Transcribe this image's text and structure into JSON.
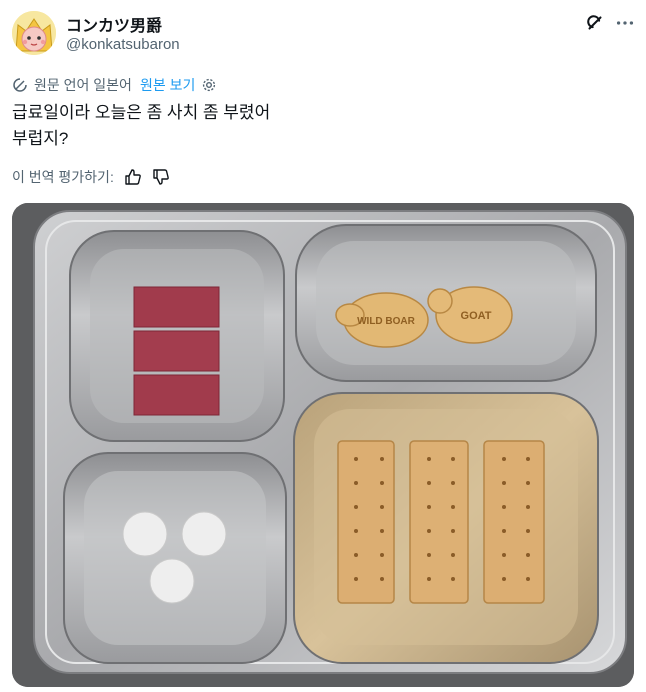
{
  "author": {
    "display_name": "コンカツ男爵",
    "handle": "@konkatsubaron"
  },
  "translation": {
    "source_label": "원문 언어 일본어",
    "show_original": "원본 보기"
  },
  "post": {
    "line1": "급료일이라 오늘은 좀 사치 좀 부렸어",
    "line2": "부럽지?"
  },
  "rating": {
    "label": "이 번역 평가하기:"
  },
  "image": {
    "cracker_left": "WILD BOAR",
    "cracker_right": "GOAT"
  },
  "icons": [
    "avatar",
    "grok-icon",
    "more-icon",
    "translate-icon",
    "settings-icon",
    "thumbs-up-icon",
    "thumbs-down-icon"
  ]
}
